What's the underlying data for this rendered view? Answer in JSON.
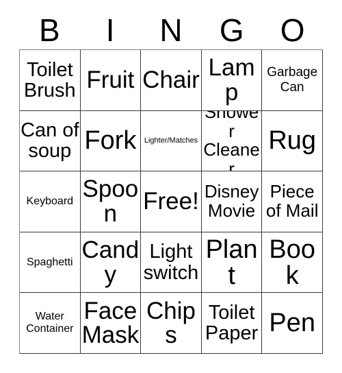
{
  "card": {
    "title": "BINGO",
    "headers": [
      "B",
      "I",
      "N",
      "G",
      "O"
    ],
    "colors": {
      "background": "#ffffff",
      "text": "#000000",
      "grid_line": "#3a3a3a"
    },
    "rows": [
      [
        {
          "label": "Toilet Brush",
          "size": "xl",
          "free": false
        },
        {
          "label": "Fruit",
          "size": "3xl",
          "free": false
        },
        {
          "label": "Chair",
          "size": "3xl",
          "free": false
        },
        {
          "label": "Lamp",
          "size": "3xl",
          "free": false
        },
        {
          "label": "Garbage Can",
          "size": "md",
          "free": false
        }
      ],
      [
        {
          "label": "Can of soup",
          "size": "xl",
          "free": false
        },
        {
          "label": "Fork",
          "size": "4xl",
          "free": false
        },
        {
          "label": "Lighter/Matches",
          "size": "xs",
          "free": false
        },
        {
          "label": "Shower Cleaner",
          "size": "lg",
          "free": false
        },
        {
          "label": "Rug",
          "size": "4xl",
          "free": false
        }
      ],
      [
        {
          "label": "Keyboard",
          "size": "sm",
          "free": false
        },
        {
          "label": "Spoon",
          "size": "3xl",
          "free": false
        },
        {
          "label": "Free!",
          "size": "3xl",
          "free": true
        },
        {
          "label": "Disney Movie",
          "size": "lg",
          "free": false
        },
        {
          "label": "Piece of Mail",
          "size": "lg",
          "free": false
        }
      ],
      [
        {
          "label": "Spaghetti",
          "size": "sm",
          "free": false
        },
        {
          "label": "Candy",
          "size": "3xl",
          "free": false
        },
        {
          "label": "Light switch",
          "size": "xl",
          "free": false
        },
        {
          "label": "Plant",
          "size": "4xl",
          "free": false
        },
        {
          "label": "Book",
          "size": "4xl",
          "free": false
        }
      ],
      [
        {
          "label": "Water Container",
          "size": "sm",
          "free": false
        },
        {
          "label": "Face Mask",
          "size": "3xl",
          "free": false
        },
        {
          "label": "Chips",
          "size": "3xl",
          "free": false
        },
        {
          "label": "Toilet Paper",
          "size": "xl",
          "free": false
        },
        {
          "label": "Pen",
          "size": "4xl",
          "free": false
        }
      ]
    ]
  }
}
